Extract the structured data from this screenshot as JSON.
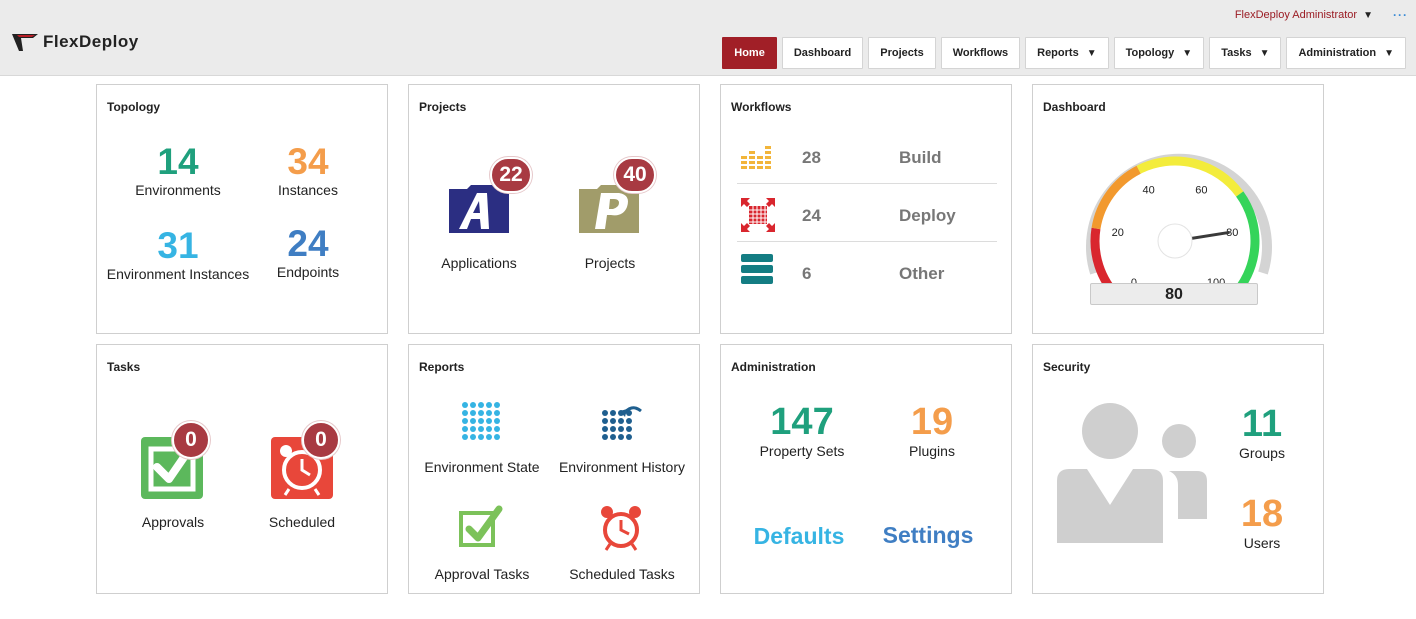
{
  "header": {
    "logo_text": "FlexDeploy",
    "user": "FlexDeploy Administrator",
    "nav": [
      {
        "label": "Home",
        "active": true,
        "caret": false
      },
      {
        "label": "Dashboard",
        "caret": false
      },
      {
        "label": "Projects",
        "caret": false
      },
      {
        "label": "Workflows",
        "caret": false
      },
      {
        "label": "Reports",
        "caret": true
      },
      {
        "label": "Topology",
        "caret": true
      },
      {
        "label": "Tasks",
        "caret": true
      },
      {
        "label": "Administration",
        "caret": true
      }
    ]
  },
  "topology": {
    "title": "Topology",
    "environments": {
      "value": "14",
      "label": "Environments"
    },
    "instances": {
      "value": "34",
      "label": "Instances"
    },
    "env_instances": {
      "value": "31",
      "label": "Environment Instances"
    },
    "endpoints": {
      "value": "24",
      "label": "Endpoints"
    }
  },
  "projects": {
    "title": "Projects",
    "applications": {
      "count": "22",
      "label": "Applications"
    },
    "projects": {
      "count": "40",
      "label": "Projects"
    }
  },
  "workflows": {
    "title": "Workflows",
    "rows": [
      {
        "count": "28",
        "name": "Build"
      },
      {
        "count": "24",
        "name": "Deploy"
      },
      {
        "count": "6",
        "name": "Other"
      }
    ]
  },
  "dashboard": {
    "title": "Dashboard",
    "gauge_value": 80,
    "gauge_readout": "80",
    "ticks": [
      "0",
      "20",
      "40",
      "60",
      "80",
      "100"
    ]
  },
  "tasks": {
    "title": "Tasks",
    "approvals": {
      "count": "0",
      "label": "Approvals"
    },
    "scheduled": {
      "count": "0",
      "label": "Scheduled"
    }
  },
  "reports": {
    "title": "Reports",
    "items": [
      "Environment State",
      "Environment History",
      "Approval Tasks",
      "Scheduled Tasks"
    ]
  },
  "administration": {
    "title": "Administration",
    "property_sets": {
      "value": "147",
      "label": "Property Sets"
    },
    "plugins": {
      "value": "19",
      "label": "Plugins"
    },
    "defaults": "Defaults",
    "settings": "Settings"
  },
  "security": {
    "title": "Security",
    "groups": {
      "value": "11",
      "label": "Groups"
    },
    "users": {
      "value": "18",
      "label": "Users"
    }
  },
  "colors": {
    "accent_red": "#a11f27",
    "teal": "#1fa07d",
    "orange": "#f49d4b",
    "sky": "#36b4e3",
    "blue": "#3f7ec3"
  }
}
